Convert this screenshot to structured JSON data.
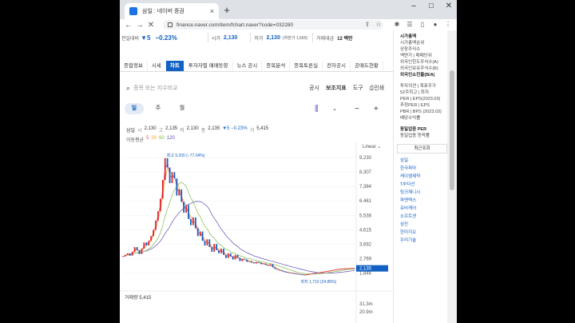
{
  "browser": {
    "tab_title": "삼일 : 네이버 증권",
    "url": "finance.naver.com/item/fchart.naver?code=032280",
    "new_tab": "+",
    "close_tab": "×",
    "min": "–",
    "max": "□",
    "close": "✕"
  },
  "quote": {
    "prev_label": "전일대비",
    "prev_change": "▼5",
    "change_pct": "−0.23%",
    "open_label": "시가",
    "open": "2,130",
    "low_label": "저가",
    "low": "2,130",
    "limit_low": "(하한가 1,500)",
    "volume_label": "거래대금",
    "volume": "12 백만"
  },
  "subtabs": [
    "종합정보",
    "시세",
    "차트",
    "투자자별 매매동향",
    "뉴스 공시",
    "종목분석",
    "종목토론실",
    "전자공시",
    "공매도현황"
  ],
  "search": {
    "placeholder": "종목 또는 지수비교",
    "notice": "공시",
    "indicator": "보조지표",
    "tool": "도구",
    "print": "인쇄"
  },
  "period": {
    "day": "일",
    "week": "주",
    "month": "월"
  },
  "ohlc": {
    "name": "삼일",
    "o_label": "시",
    "o": "2,130",
    "h_label": "고",
    "h": "2,135",
    "l_label": "저",
    "l": "2,130",
    "c_label": "종",
    "c": "2,135",
    "chg": "▼5 −0.23%",
    "v_label": "거",
    "v": "5,415"
  },
  "ma": {
    "label": "이동평균",
    "m5": "5",
    "m20": "20",
    "m60": "60",
    "m120": "120"
  },
  "colors": {
    "up": "#e0292e",
    "down": "#1261c4",
    "ma5": "#e84e60",
    "ma20": "#f0a030",
    "ma60": "#7fba4f",
    "ma120": "#5f4bb6"
  },
  "chart_data": {
    "type": "line",
    "scale_label": "Linear",
    "y_ticks": [
      "9,230",
      "8,307",
      "7,384",
      "6,461",
      "5,538",
      "4,615",
      "3,692",
      "2,769",
      "1,846"
    ],
    "high_label": "최고 9,200 (−77.04%)",
    "low_label": "최저 1,710 (24.85%)",
    "last_price": "2,135",
    "ylim": [
      1400,
      9600
    ],
    "close": [
      2900,
      3000,
      3100,
      2950,
      3200,
      3500,
      3300,
      3050,
      3400,
      3800,
      3600,
      3900,
      4200,
      4600,
      5200,
      5800,
      6600,
      7800,
      9200,
      8600,
      7600,
      8300,
      7900,
      6800,
      7200,
      6400,
      5700,
      6200,
      5300,
      4900,
      5400,
      4700,
      4200,
      4500,
      3900,
      3600,
      4000,
      3500,
      3200,
      3700,
      3300,
      3100,
      3400,
      3000,
      2800,
      3100,
      2900,
      2700,
      3000,
      2800,
      2600,
      2750,
      2700,
      2550,
      2600,
      2500,
      2450,
      2550,
      2500,
      2400,
      2450,
      2350,
      2300,
      2400,
      2200,
      2100,
      2050,
      2000,
      1950,
      1900,
      1880,
      1850,
      1820,
      1800,
      1780,
      1760,
      1740,
      1720,
      1710,
      1760,
      1780,
      1820,
      1800,
      1850,
      1880,
      1900,
      1920,
      1950,
      1980,
      2000,
      2030,
      2060,
      2080,
      2100,
      2110,
      2120,
      2125,
      2130,
      2140,
      2135
    ],
    "volume_label": "거래량 5,415",
    "vol_ticks": [
      "31.3m",
      "20.9m"
    ]
  },
  "sidebar": {
    "items": [
      "시가총액",
      "시가총액순위",
      "상장주식수",
      "액면가 | 매매단위",
      "외국인한도주식수(A)",
      "외국인보유주식수(B)",
      "외국인소진율(B/A)",
      "투자의견 | 목표주가",
      "52주최고 | 최저",
      "PER | EPS(2023.03)",
      "추정PER | EPS",
      "PBR | BPS (2023.03)",
      "배당수익률",
      "동일업종 PER",
      "동일업종 등락률"
    ],
    "recent_title": "최근조회",
    "recent": [
      "삼일",
      "한국파마",
      "케이엠제약",
      "T/P다산",
      "링크제니시",
      "파멘텍스",
      "유비케어",
      "소프트센",
      "삼진",
      "한미지오",
      "우리기술"
    ]
  }
}
